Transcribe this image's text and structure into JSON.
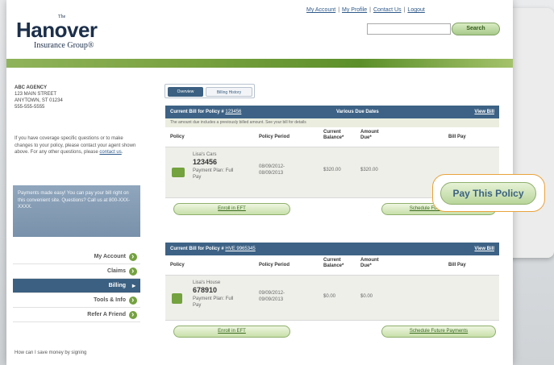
{
  "header": {
    "logo_the": "The",
    "logo_main": "Hanover",
    "logo_sub": "Insurance Group®",
    "links": [
      "My Account",
      "My Profile",
      "Contact Us",
      "Logout"
    ],
    "search_value": "",
    "search_button": "Search"
  },
  "agency": {
    "name": "ABC AGENCY",
    "street": "123 MAIN STREET",
    "city": "ANYTOWN, ST 01234",
    "phone": "555-555-5555"
  },
  "help_text_pre": "If you have coverage specific questions or to make changes to your policy, please contact your agent shown above. For any other questions, please",
  "help_link": "contact us",
  "promo_text": "Payments made easy! You can pay your bill right on this convenient site. Questions? Call us at 800-XXX-XXXX.",
  "nav": {
    "items": [
      {
        "label": "My Account",
        "active": false
      },
      {
        "label": "Claims",
        "active": false
      },
      {
        "label": "Billing",
        "active": true
      },
      {
        "label": "Tools & Info",
        "active": false
      },
      {
        "label": "Refer A Friend",
        "active": false
      }
    ]
  },
  "savings_text": "How can I save money by signing",
  "tabs": {
    "overview": "Overview",
    "billing": "Billing History"
  },
  "columns": {
    "policy": "Policy",
    "period": "Policy Period",
    "current": "Current Balance*",
    "due": "Amount Due*",
    "pay": "Bill Pay"
  },
  "bills": [
    {
      "title_prefix": "Current Bill for Policy #",
      "policy_ref": "123456",
      "due_text": "Various Due Dates",
      "view_link": "View Bill",
      "note": "The amount due includes a previously billed amount. See your bill for details",
      "item_name": "Lisa's Cars",
      "policy_number": "123456",
      "plan": "Payment Plan: Full",
      "plan2": "Pay",
      "period_start": "08/09/2012-",
      "period_end": "08/09/2013",
      "current_balance": "$320.00",
      "amount_due": "$320.00",
      "eft_button": "Enroll in EFT",
      "schedule_button": "Schedule Future Payments"
    },
    {
      "title_prefix": "Current Bill for Policy #",
      "policy_ref": "HVE 9965345",
      "due_text": "",
      "view_link": "View Bill",
      "note": "",
      "item_name": "Lisa's House",
      "policy_number": "678910",
      "plan": "Payment Plan: Full",
      "plan2": "Pay",
      "period_start": "09/09/2012-",
      "period_end": "09/09/2013",
      "current_balance": "$0.00",
      "amount_due": "$0.00",
      "eft_button": "Enroll in EFT",
      "schedule_button": "Schedule Future Payments"
    }
  ],
  "pay_button": "Pay This Policy",
  "colors": {
    "navy": "#1c2f4a",
    "bar_blue": "#3d6285",
    "green": "#73a23e",
    "highlight": "#e9a33c"
  }
}
